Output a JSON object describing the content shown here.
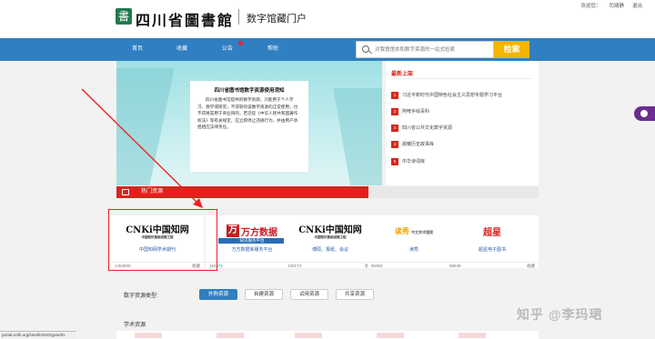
{
  "top_links": [
    "欢迎您：",
    "司琦静",
    "退出"
  ],
  "header": {
    "logo_glyph": "書",
    "site_name": "四川省圖書館",
    "portal_name": "数字馆藏门户"
  },
  "nav": {
    "items": [
      "首页",
      "收藏",
      "公告",
      "帮助"
    ],
    "search_placeholder": "对我馆馆本和数字资源的一站式检索",
    "search_button": "检索"
  },
  "notice": {
    "title": "四川省图书馆数字资源使用须知",
    "body": "四川省图书馆提供的数字资源，只能用于个人学习、教学或研究，不得影响该数字资源的正常使用，也不得将其用于商业目的，若违反《中华人民共和国著作权法》等有关规定，应立即停止违规行为，并由用户承担相应法律责任。"
  },
  "new_arrivals": {
    "title": "最新上架",
    "items": [
      "习近平新时代中国特色社会主义思想专题学习平台",
      "阿啤手绘百科",
      "四川省公共文化数字资源",
      "晨曦历史故事库",
      "中华诗词库"
    ]
  },
  "section": {
    "title": "热门资源"
  },
  "cards": [
    {
      "logo": "CNKi中国知网",
      "logo_sub": "中国知识基础设施工程",
      "name": "中国知网学术期刊",
      "views": "1452809",
      "fav": "收藏"
    },
    {
      "logo": "万方数据",
      "logo_sub": "WANFANG DATA",
      "strip": "知识服务平台",
      "name": "万方数据库服务平台",
      "views": "154971",
      "fav": "收藏"
    },
    {
      "logo": "CNKi中国知网",
      "logo_sub": "中国知识基础设施工程",
      "name": "博硕、报纸、会议",
      "views": "130173",
      "fav": "收藏"
    },
    {
      "logo": "读秀",
      "logo_sub": "中文学术搜索",
      "name": "读秀",
      "views": "95253",
      "fav": "收藏"
    },
    {
      "logo": "超星",
      "name": "超星电子图书",
      "views": "88849",
      "fav": "收藏"
    }
  ],
  "filters": {
    "label": "数字资源类型:",
    "options": [
      "外购资源",
      "自建资源",
      "试用资源",
      "共享资源"
    ],
    "active": "外购资源"
  },
  "academic_label": "学术资源",
  "status_url": "portal.sclib.org/interlibSSO/goto/91",
  "watermark": "知乎 @李玛珺",
  "colors": {
    "nav_blue": "#2f7fc1",
    "accent_red": "#d9251d",
    "search_yellow": "#f4b400"
  }
}
